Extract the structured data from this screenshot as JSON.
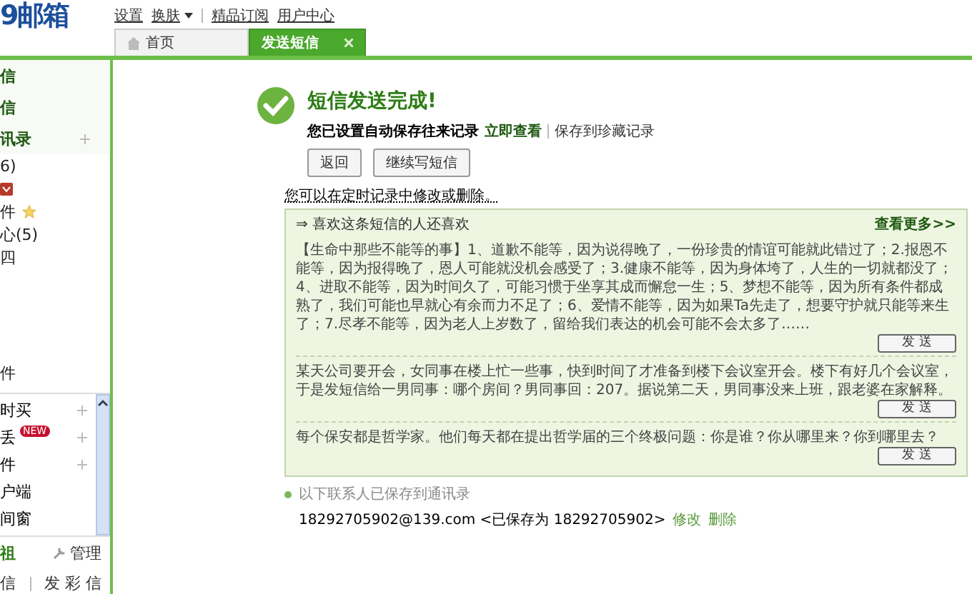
{
  "logo": "9邮箱",
  "top_nav": [
    {
      "label": "设置",
      "dropdown": false
    },
    {
      "label": "换肤",
      "dropdown": true
    },
    {
      "label": "精品订阅",
      "dropdown": false
    },
    {
      "label": "用户中心",
      "dropdown": false
    }
  ],
  "tabs": [
    {
      "label": "首页",
      "selected": false,
      "home": true,
      "closable": false
    },
    {
      "label": "发送短信",
      "selected": true,
      "home": false,
      "closable": true
    }
  ],
  "sidebar": {
    "items": [
      {
        "label": "信",
        "bold": true
      },
      {
        "label": "信",
        "bold": true
      },
      {
        "label": "讯录",
        "bold": true,
        "add": true
      },
      {
        "label": "6)"
      },
      {
        "kind": "mail"
      },
      {
        "label": "件",
        "kind": "star"
      },
      {
        "label": "心(5)"
      },
      {
        "label": "四"
      }
    ],
    "lower_title": "件",
    "apps": [
      {
        "label": "时买",
        "add": true
      },
      {
        "label": "丢",
        "badge": "NEW",
        "add": true
      },
      {
        "label": "件",
        "add": true
      },
      {
        "label": "户端"
      },
      {
        "label": "间窗"
      }
    ],
    "footer_left": "祖",
    "manage": "管理",
    "footer_link_left": "信",
    "footer_link_right": "发 彩 信"
  },
  "result": {
    "title": "短信发送完成!",
    "note": "您已设置自动保存往来记录",
    "view_link": "立即查看",
    "save_link": "保存到珍藏记录",
    "buttons": [
      "返回",
      "继续写短信"
    ],
    "hint": "您可以在定时记录中修改或删除。"
  },
  "recommend": {
    "title": "⇒ 喜欢这条短信的人还喜欢",
    "more": "查看更多>>",
    "messages": [
      {
        "text": "【生命中那些不能等的事】1、道歉不能等，因为说得晚了，一份珍贵的情谊可能就此错过了；2.报恩不能等，因为报得晚了，恩人可能就没机会感受了；3.健康不能等，因为身体垮了，人生的一切就都没了；4、进取不能等，因为时间久了，可能习惯于坐享其成而懈怠一生；5、梦想不能等，因为所有条件都成熟了，我们可能也早就心有余而力不足了；6、爱情不能等，因为如果Ta先走了，想要守护就只能等来生了；7.尽孝不能等，因为老人上岁数了，留给我们表达的机会可能不会太多了……",
        "button": "发 送"
      },
      {
        "text": "某天公司要开会，女同事在楼上忙一些事，快到时间了才准备到楼下会议室开会。楼下有好几个会议室，于是发短信给一男同事：哪个房间？男同事回：207。据说第二天，男同事没来上班，跟老婆在家解释。",
        "button": "发 送"
      },
      {
        "text": "每个保安都是哲学家。他们每天都在提出哲学届的三个终极问题：你是谁？你从哪里来？你到哪里去？",
        "button": "发 送"
      }
    ]
  },
  "saved": {
    "title": "以下联系人已保存到通讯录",
    "contact": "18292705902@139.com <已保存为 18292705902>",
    "edit": "修改",
    "delete": "删除"
  }
}
